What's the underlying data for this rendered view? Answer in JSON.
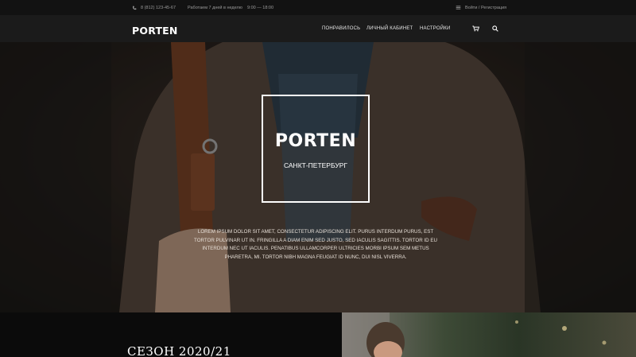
{
  "topbar": {
    "phone": "8 (812) 123-45-67",
    "days": "Работаем 7 дней в неделю",
    "hours": "9:00 — 18:00",
    "login": "Войти / Регистрация"
  },
  "header": {
    "logo": "PORTEN",
    "nav": [
      "ПОНРАВИЛОСЬ",
      "ЛИЧНЫЙ КАБИНЕТ",
      "НАСТРОЙКИ"
    ]
  },
  "hero": {
    "title": "PORTEN",
    "subtitle": "САНКТ-ПЕТЕРБУРГ",
    "text": "Lorem ipsum dolor sit amet, consectetur adipiscing elit. Purus interdum purus, est tortor pulvinar ut in. Fringilla a diam enim sed justo, sed iaculis sagittis. Tortor id eu interdum nec ut iaculis. Penatibus ullamcorper ultricies morbi ipsum sem metus pharetra, mi. Tortor nibh magna feugiat id nunc, dui nisl viverra."
  },
  "section": {
    "title": "СЕЗОН 2020/21"
  },
  "colors": {
    "topbar_bg": "#121212",
    "header_bg": "#1b1b1b",
    "accent_text": "#ffffff"
  },
  "icons": [
    "phone-icon",
    "login-icon",
    "cart-icon",
    "search-icon"
  ]
}
